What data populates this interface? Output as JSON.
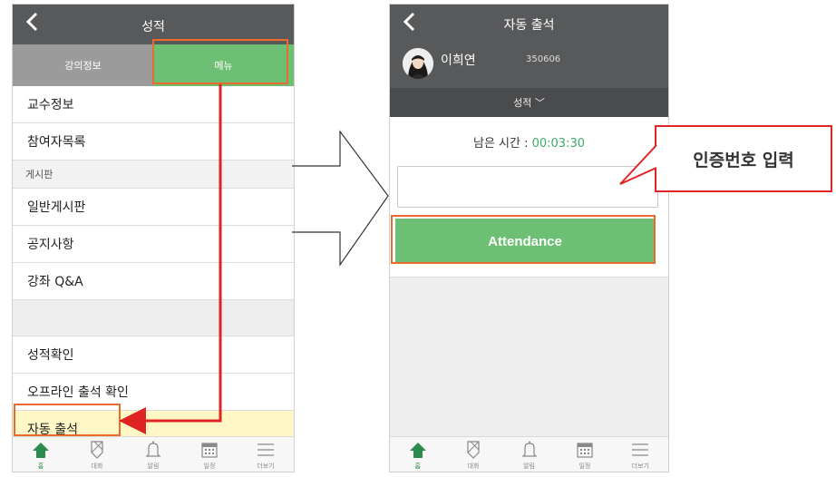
{
  "left": {
    "title": "성적",
    "tabs": [
      {
        "label": "강의정보"
      },
      {
        "label": "메뉴"
      }
    ],
    "menu": {
      "professor_info": "교수정보",
      "participants": "참여자목록",
      "board_section": "게시판",
      "general_board": "일반게시판",
      "notice": "공지사항",
      "qna": "강좌 Q&A",
      "grade_check": "성적확인",
      "offline_attendance": "오프라인 출석 확인",
      "auto_attendance": "자동 출석"
    }
  },
  "right": {
    "title": "자동 출석",
    "user": {
      "name": "이희연",
      "id": "350606"
    },
    "course_dropdown": "성적 ﹀",
    "timer_label": "남은 시간 : ",
    "timer_value": "00:03:30",
    "code_input": {
      "value": "",
      "placeholder": ""
    },
    "attendance_button": "Attendance"
  },
  "tabbar": [
    {
      "label": "홈",
      "icon": "home-icon"
    },
    {
      "label": "대화",
      "icon": "chat-icon"
    },
    {
      "label": "알림",
      "icon": "bell-icon"
    },
    {
      "label": "일정",
      "icon": "calendar-icon"
    },
    {
      "label": "더보기",
      "icon": "more-icon"
    }
  ],
  "callout": {
    "text": "인증번호 입력"
  },
  "colors": {
    "header": "#58595b",
    "accent_green": "#6cbf73",
    "highlight_orange": "#ea6b2c",
    "arrow_red": "#e02424",
    "timer_green": "#3fa96b"
  }
}
